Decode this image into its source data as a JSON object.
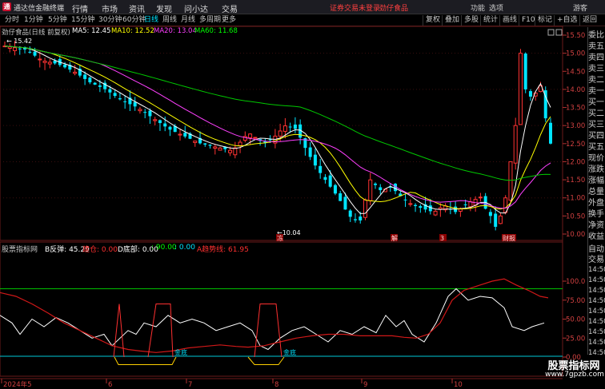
{
  "app": {
    "title": "通达信金融终端",
    "menu": [
      "行情",
      "市场",
      "资讯",
      "发现",
      "问小达",
      "交易"
    ],
    "login_status": "证券交易未登录",
    "stock_tag": "劲仔食品",
    "window_controls": [
      "功能",
      "选项",
      "游客"
    ]
  },
  "toolbar": {
    "periods": [
      "分时",
      "1分钟",
      "5分钟",
      "15分钟",
      "30分钟",
      "60分钟",
      "日线",
      "周线",
      "月线",
      "多周期",
      "更多"
    ],
    "active_period": "日线",
    "right_buttons": [
      "复权",
      "叠加",
      "多股",
      "统计",
      "画线",
      "F10",
      "标记",
      "+自选",
      "返回"
    ]
  },
  "main_chart": {
    "stock_label": "劲仔食品(日线 前复权)",
    "ma": [
      {
        "label": "MA5: 12.45",
        "color": "#ffffff"
      },
      {
        "label": "MA10: 12.52",
        "color": "#ffff00"
      },
      {
        "label": "MA20: 13.04",
        "color": "#ff40ff"
      },
      {
        "label": "MA60: 11.68",
        "color": "#00ff00"
      }
    ],
    "high_label": "15.42",
    "low_label": "10.04",
    "price_ticks": [
      "15.50",
      "15.00",
      "14.50",
      "14.00",
      "13.50",
      "13.00",
      "12.50",
      "12.00",
      "11.50",
      "11.00",
      "10.50",
      "10.00"
    ],
    "event_markers": [
      "冻",
      "解",
      "3",
      "财报"
    ]
  },
  "indicator": {
    "name": "股票指标网",
    "values": [
      {
        "label": "B反弹: 45.29",
        "color": "#ffffff"
      },
      {
        "label": "建仓: 0.00",
        "color": "#ff3030"
      },
      {
        "label": "D底部: 0.00",
        "color": "#ffffff"
      },
      {
        "label": ": 90.00",
        "color": "#00ff00"
      },
      {
        "label": ": 0.00",
        "color": "#00e5ff"
      },
      {
        "label": "A趋势线: 61.95",
        "color": "#ff3030"
      }
    ],
    "ticks": [
      "100.0",
      "75.00",
      "50.00",
      "25.00",
      "0.00"
    ],
    "bottom_labels": [
      "金底",
      "金底"
    ]
  },
  "time_axis": [
    "2024年5",
    "6",
    "7",
    "8",
    "9",
    "10"
  ],
  "sidebar_quote": [
    "委比",
    "卖五",
    "卖四",
    "卖三",
    "卖二",
    "卖一",
    "买一",
    "买二",
    "买三",
    "买四",
    "买五",
    "现价",
    "涨跌",
    "涨幅",
    "总量",
    "外盘",
    "换手",
    "净资",
    "收益"
  ],
  "sidebar_lower": [
    "自动",
    "交易",
    "14:50",
    "14:50",
    "14:50",
    "14:50",
    "14:50",
    "14:50",
    "14:50",
    "14:50",
    "14:50"
  ],
  "watermark": {
    "main": "股票指标网",
    "sub": "www.7gpzb.com"
  }
}
